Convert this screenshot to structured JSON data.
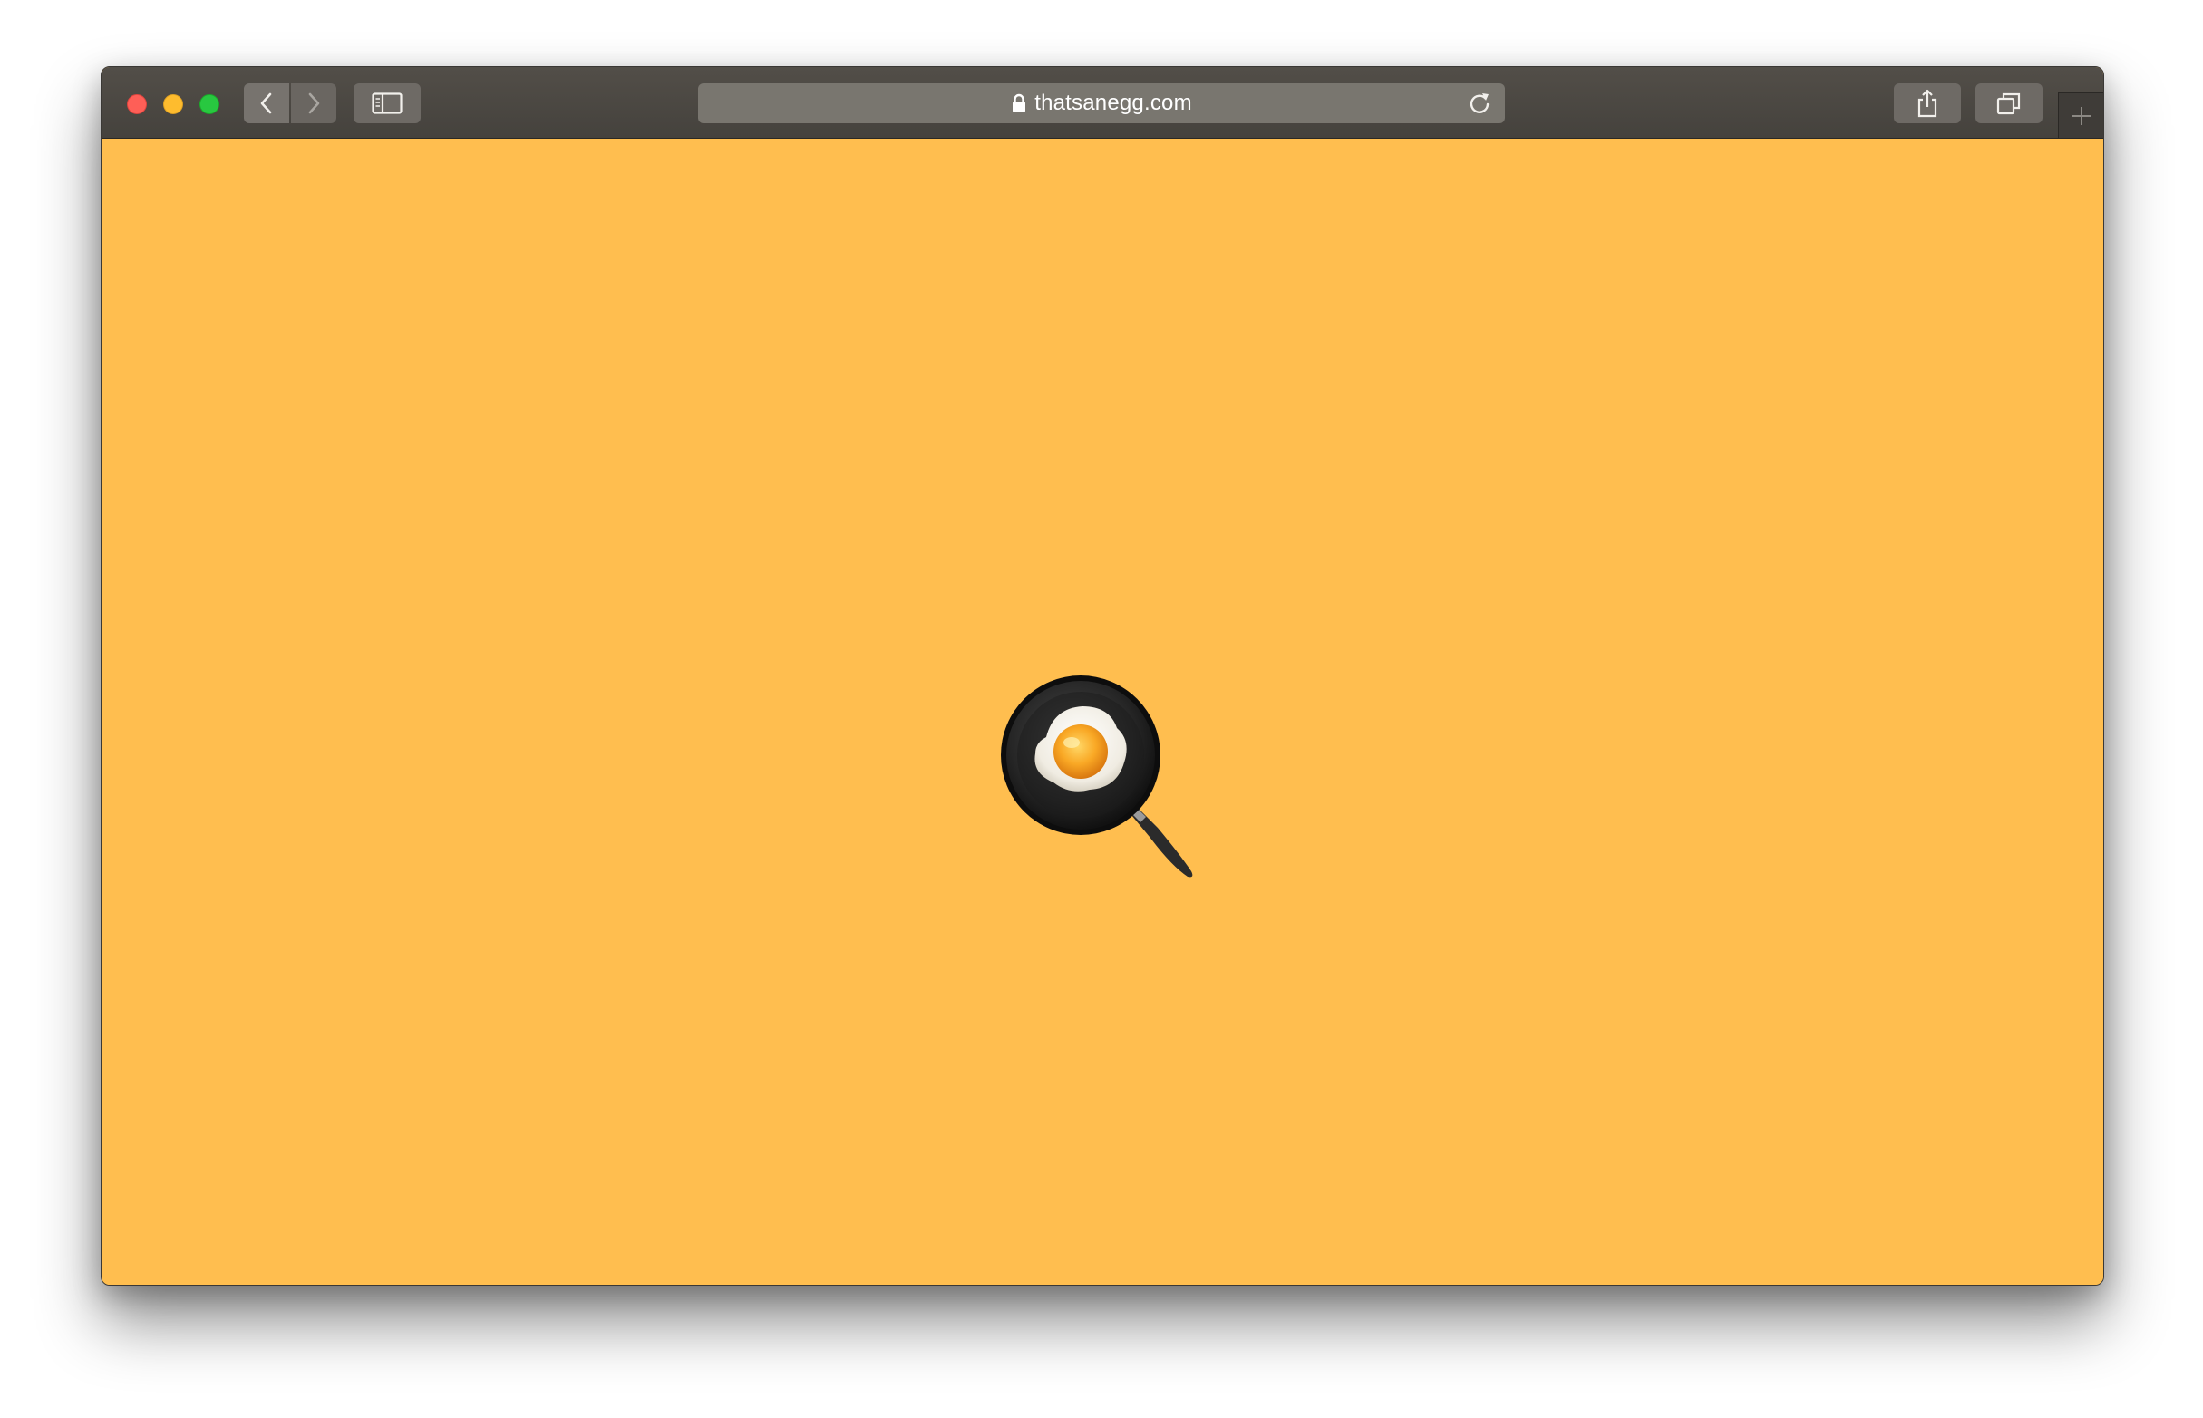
{
  "browser": {
    "url": "thatsanegg.com",
    "background_color": "#ffbe4f",
    "toolbar_color": "#4a4742"
  },
  "page": {
    "content_icon": "cooking-egg-in-pan-icon"
  },
  "icons": {
    "back": "chevron-left-icon",
    "forward": "chevron-right-icon",
    "sidebar": "sidebar-icon",
    "lock": "lock-icon",
    "reload": "reload-icon",
    "share": "share-icon",
    "tabs": "tabs-overview-icon",
    "new_tab": "plus-icon"
  }
}
